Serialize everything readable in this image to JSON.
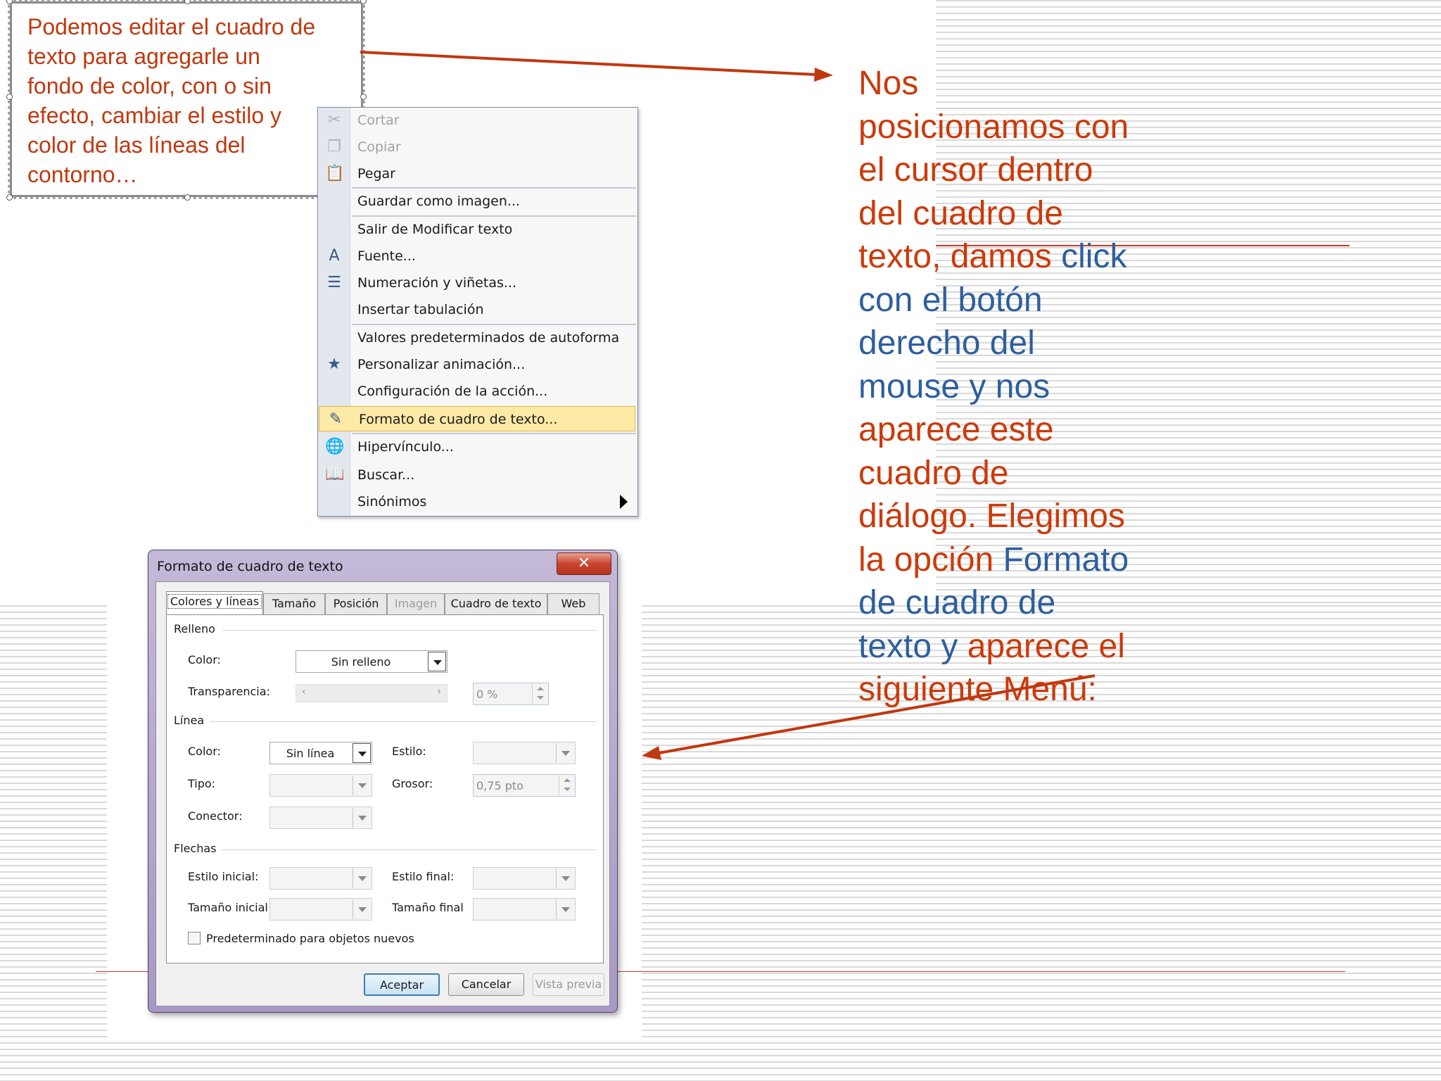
{
  "note_box": {
    "lines": [
      "Podemos editar el cuadro de",
      "texto para agregarle un",
      "fondo de color, con o sin",
      "efecto, cambiar el estilo y",
      "color de las líneas del",
      "contorno…"
    ]
  },
  "instruction": {
    "lines": [
      [
        {
          "t": "Nos",
          "c": "red"
        }
      ],
      [
        {
          "t": "posicionamos con",
          "c": "red"
        }
      ],
      [
        {
          "t": "el cursor dentro",
          "c": "red"
        }
      ],
      [
        {
          "t": "del cuadro de",
          "c": "red"
        }
      ],
      [
        {
          "t": "texto, damos ",
          "c": "red"
        },
        {
          "t": "click",
          "c": "blue"
        }
      ],
      [
        {
          "t": "con el botón",
          "c": "blue"
        }
      ],
      [
        {
          "t": "derecho del",
          "c": "blue"
        }
      ],
      [
        {
          "t": "mouse y nos",
          "c": "blue"
        }
      ],
      [
        {
          "t": "aparece este",
          "c": "red"
        }
      ],
      [
        {
          "t": "cuadro de",
          "c": "red"
        }
      ],
      [
        {
          "t": "diálogo. Elegimos",
          "c": "red"
        }
      ],
      [
        {
          "t": "la opción ",
          "c": "red"
        },
        {
          "t": "Formato",
          "c": "blue"
        }
      ],
      [
        {
          "t": "de cuadro de",
          "c": "blue"
        }
      ],
      [
        {
          "t": "texto y ",
          "c": "blue"
        },
        {
          "t": "aparece el",
          "c": "red"
        }
      ],
      [
        {
          "t": "siguiente Menú:",
          "c": "red"
        }
      ]
    ]
  },
  "context_menu": {
    "items": [
      {
        "label": "Cortar",
        "icon": "scissors-icon",
        "glyph": "✂",
        "disabled": true
      },
      {
        "label": "Copiar",
        "icon": "copy-icon",
        "glyph": "❐",
        "disabled": true
      },
      {
        "label": "Pegar",
        "icon": "paste-icon",
        "glyph": "📋",
        "disabled": false
      },
      {
        "label": "Guardar como imagen...",
        "icon": "",
        "glyph": "",
        "disabled": false
      },
      {
        "label": "Salir de Modificar texto",
        "icon": "",
        "glyph": "",
        "disabled": false
      },
      {
        "label": "Fuente...",
        "icon": "font-icon",
        "glyph": "A",
        "disabled": false
      },
      {
        "label": "Numeración y viñetas...",
        "icon": "bullets-icon",
        "glyph": "☰",
        "disabled": false
      },
      {
        "label": "Insertar tabulación",
        "icon": "",
        "glyph": "",
        "disabled": false
      },
      {
        "label": "Valores predeterminados de autoforma",
        "icon": "",
        "glyph": "",
        "disabled": false
      },
      {
        "label": "Personalizar animación...",
        "icon": "animation-icon",
        "glyph": "★",
        "disabled": false
      },
      {
        "label": "Configuración de la acción...",
        "icon": "",
        "glyph": "",
        "disabled": false
      },
      {
        "label": "Formato de cuadro de texto...",
        "icon": "format-icon",
        "glyph": "✎",
        "disabled": false,
        "highlight": true
      },
      {
        "label": "Hipervínculo...",
        "icon": "hyperlink-icon",
        "glyph": "🌐",
        "disabled": false
      },
      {
        "label": "Buscar...",
        "icon": "search-icon",
        "glyph": "📖",
        "disabled": false
      },
      {
        "label": "Sinónimos",
        "icon": "",
        "glyph": "",
        "disabled": false,
        "submenu": true
      }
    ]
  },
  "dialog": {
    "title": "Formato de cuadro de texto",
    "close_glyph": "✕",
    "tabs": [
      "Colores y líneas",
      "Tamaño",
      "Posición",
      "Imagen",
      "Cuadro de texto",
      "Web"
    ],
    "groups": {
      "fill": "Relleno",
      "line": "Línea",
      "arrows": "Flechas"
    },
    "fill": {
      "color_label": "Color:",
      "color_value": "Sin relleno",
      "transparency_label": "Transparencia:",
      "transparency_value": "0 %",
      "slider_left": "‹",
      "slider_right": "›"
    },
    "line": {
      "color_label": "Color:",
      "color_value": "Sin línea",
      "style_label": "Estilo:",
      "type_label": "Tipo:",
      "weight_label": "Grosor:",
      "weight_value": "0,75 pto",
      "connector_label": "Conector:"
    },
    "arrows": {
      "begin_style_label": "Estilo inicial:",
      "end_style_label": "Estilo final:",
      "begin_size_label": "Tamaño inicial",
      "end_size_label": "Tamaño final"
    },
    "default_checkbox_label": "Predeterminado para objetos nuevos",
    "buttons": {
      "ok": "Aceptar",
      "cancel": "Cancelar",
      "preview": "Vista previa"
    }
  },
  "colors": {
    "text_red": "#cc3a0a",
    "text_blue": "#2e5f9e",
    "arrow": "#c0380f",
    "menu_highlight": "#fdeaa6"
  }
}
